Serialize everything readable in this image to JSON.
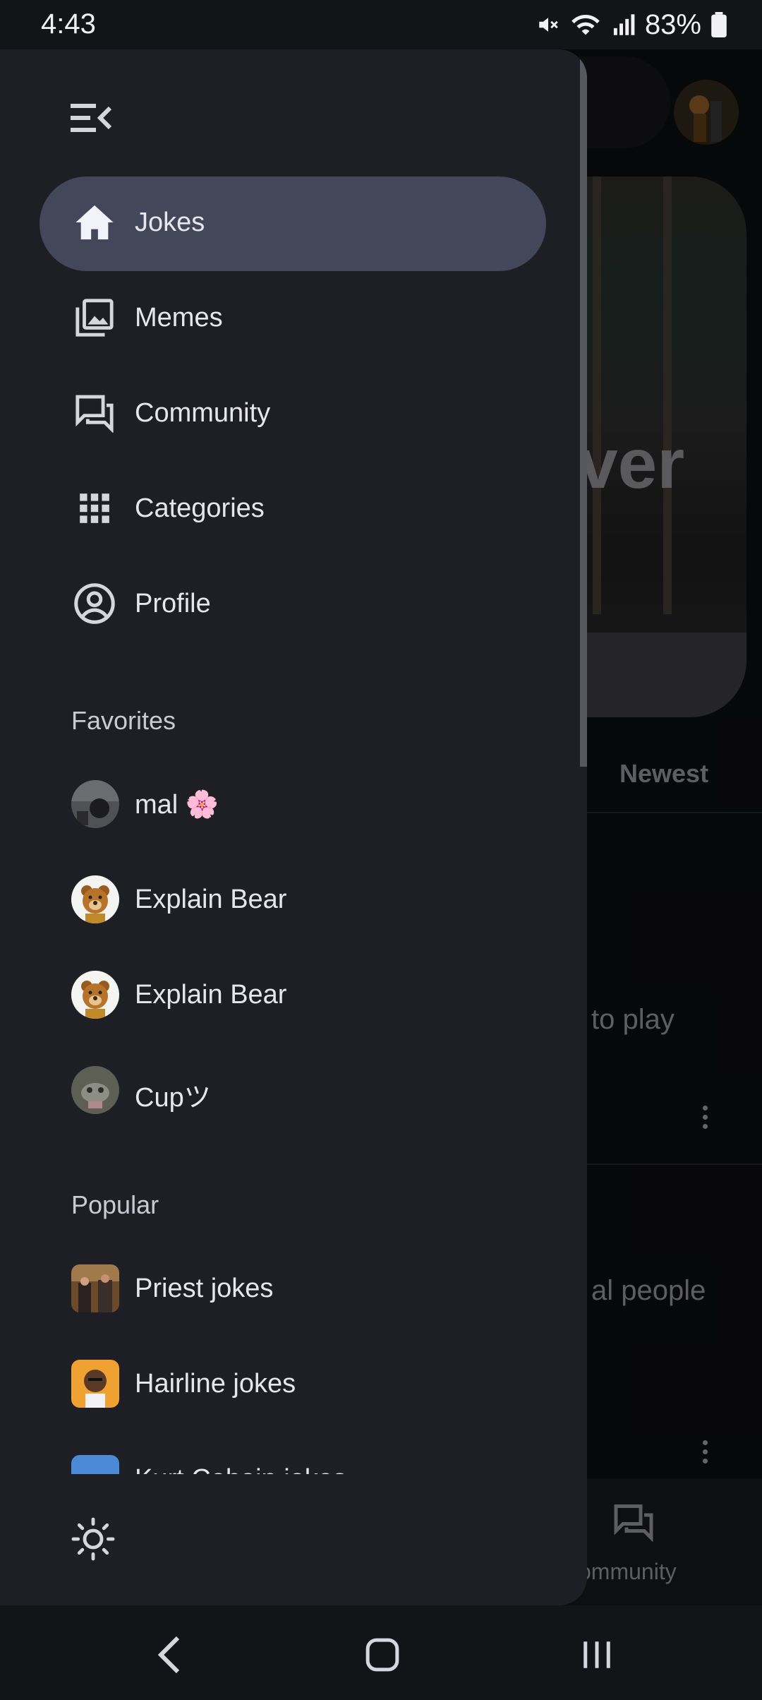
{
  "status_bar": {
    "time": "4:43",
    "battery_percent": "83%",
    "icons": [
      "mute-icon",
      "wifi-icon",
      "signal-icon",
      "battery-icon"
    ]
  },
  "background": {
    "hero_text": "ver",
    "tab_newest": "Newest",
    "snippet_1": "to play",
    "snippet_2": "al people",
    "bottom_nav_community": "ommunity"
  },
  "drawer": {
    "nav_items": [
      {
        "label": "Jokes",
        "icon": "home-icon",
        "active": true
      },
      {
        "label": "Memes",
        "icon": "gallery-icon",
        "active": false
      },
      {
        "label": "Community",
        "icon": "forum-icon",
        "active": false
      },
      {
        "label": "Categories",
        "icon": "grid-icon",
        "active": false
      },
      {
        "label": "Profile",
        "icon": "account-circle-icon",
        "active": false
      }
    ],
    "favorites_title": "Favorites",
    "favorites": [
      {
        "label": "mal 🌸",
        "avatar": "mal-avatar"
      },
      {
        "label": "Explain Bear",
        "avatar": "bear-avatar"
      },
      {
        "label": "Explain Bear",
        "avatar": "bear-avatar"
      },
      {
        "label": "Cupツ",
        "avatar": "cup-avatar"
      }
    ],
    "popular_title": "Popular",
    "popular": [
      {
        "label": "Priest jokes"
      },
      {
        "label": "Hairline jokes"
      },
      {
        "label": "Kurt Cobain jokes"
      }
    ]
  },
  "colors": {
    "drawer_bg": "#1e1f25",
    "active_pill": "#44475a",
    "text": "#e6e6ec"
  }
}
